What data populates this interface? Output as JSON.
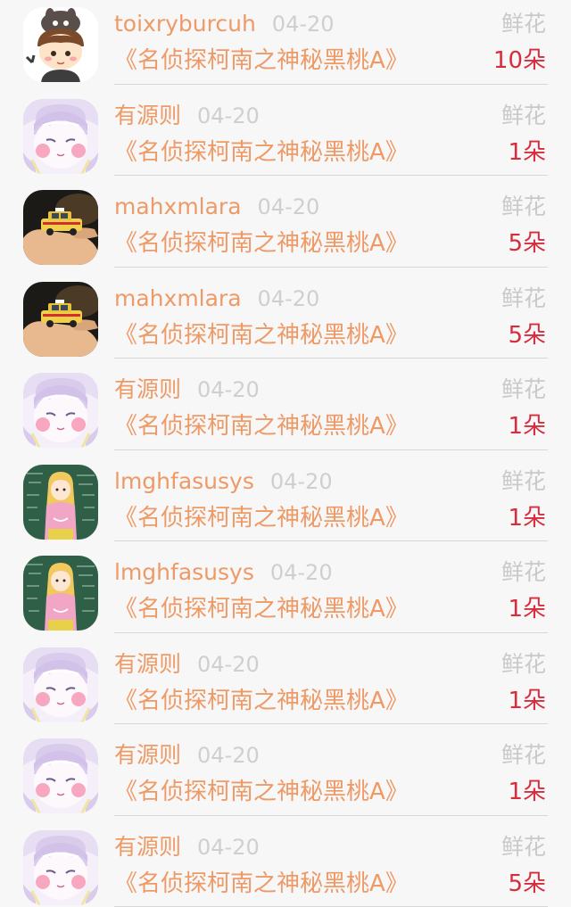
{
  "colors": {
    "username": "#ee9a66",
    "date": "#cfcfcf",
    "gift_label": "#c9c9c9",
    "count": "#d62c3c",
    "divider": "#d7d7d7",
    "background": "#f7f7f8"
  },
  "records": [
    {
      "avatar": "totoro-boy-avatar-icon",
      "username": "toixryburcuh",
      "date": "04-20",
      "gift_label": "鲜花",
      "book_title": "《名侦探柯南之神秘黑桃A》",
      "count": "10朵"
    },
    {
      "avatar": "anime-girl-avatar-icon",
      "username": "有源则",
      "date": "04-20",
      "gift_label": "鲜花",
      "book_title": "《名侦探柯南之神秘黑桃A》",
      "count": "1朵"
    },
    {
      "avatar": "taxi-toy-avatar-icon",
      "username": "mahxmlara",
      "date": "04-20",
      "gift_label": "鲜花",
      "book_title": "《名侦探柯南之神秘黑桃A》",
      "count": "5朵"
    },
    {
      "avatar": "taxi-toy-avatar-icon",
      "username": "mahxmlara",
      "date": "04-20",
      "gift_label": "鲜花",
      "book_title": "《名侦探柯南之神秘黑桃A》",
      "count": "5朵"
    },
    {
      "avatar": "anime-girl-avatar-icon",
      "username": "有源则",
      "date": "04-20",
      "gift_label": "鲜花",
      "book_title": "《名侦探柯南之神秘黑桃A》",
      "count": "1朵"
    },
    {
      "avatar": "chalkboard-girl-avatar-icon",
      "username": "lmghfasusys",
      "date": "04-20",
      "gift_label": "鲜花",
      "book_title": "《名侦探柯南之神秘黑桃A》",
      "count": "1朵"
    },
    {
      "avatar": "chalkboard-girl-avatar-icon",
      "username": "lmghfasusys",
      "date": "04-20",
      "gift_label": "鲜花",
      "book_title": "《名侦探柯南之神秘黑桃A》",
      "count": "1朵"
    },
    {
      "avatar": "anime-girl-avatar-icon",
      "username": "有源则",
      "date": "04-20",
      "gift_label": "鲜花",
      "book_title": "《名侦探柯南之神秘黑桃A》",
      "count": "1朵"
    },
    {
      "avatar": "anime-girl-avatar-icon",
      "username": "有源则",
      "date": "04-20",
      "gift_label": "鲜花",
      "book_title": "《名侦探柯南之神秘黑桃A》",
      "count": "1朵"
    },
    {
      "avatar": "anime-girl-avatar-icon",
      "username": "有源则",
      "date": "04-20",
      "gift_label": "鲜花",
      "book_title": "《名侦探柯南之神秘黑桃A》",
      "count": "5朵"
    }
  ]
}
